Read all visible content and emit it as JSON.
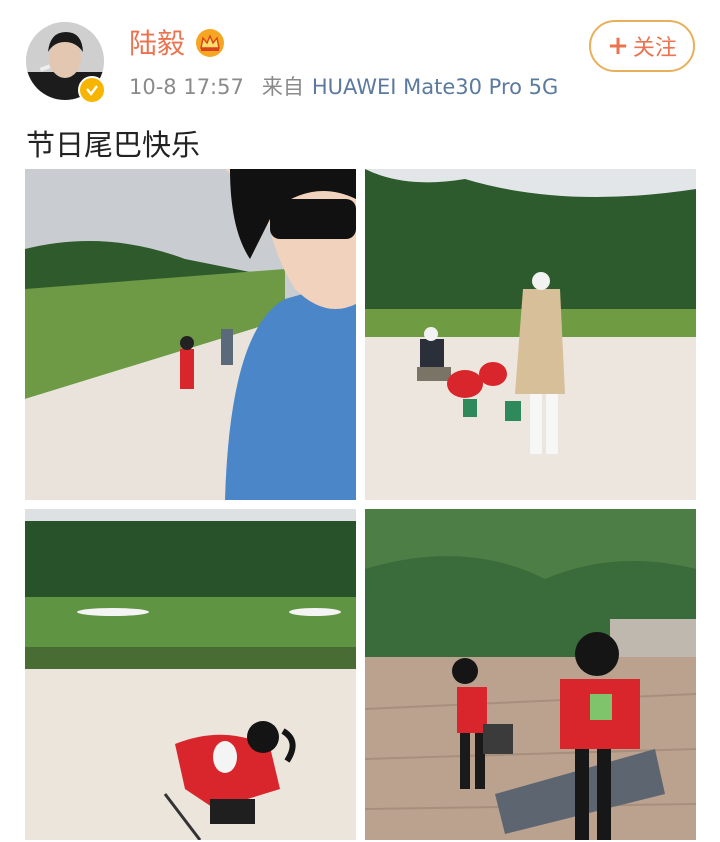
{
  "post": {
    "user": {
      "name": "陆毅",
      "verified": true,
      "crown_badge": "crown-icon"
    },
    "date": "10-8 17:57",
    "source_prefix": "来自",
    "source_device": "HUAWEI Mate30 Pro 5G",
    "follow_button": {
      "plus": "+",
      "label": "关注"
    },
    "text": "节日尾巴快乐",
    "images": [
      "golf-bunker-selfie-photo",
      "golf-bunker-adults-child-photo",
      "child-in-sand-bunker-photo",
      "girls-carrying-golf-bags-photo"
    ]
  },
  "colors": {
    "username": "#eb7350",
    "link": "#5b7a9d",
    "meta": "#8a8a8a",
    "follow_border": "#e8b05a",
    "verified_badge": "#f7b500"
  }
}
